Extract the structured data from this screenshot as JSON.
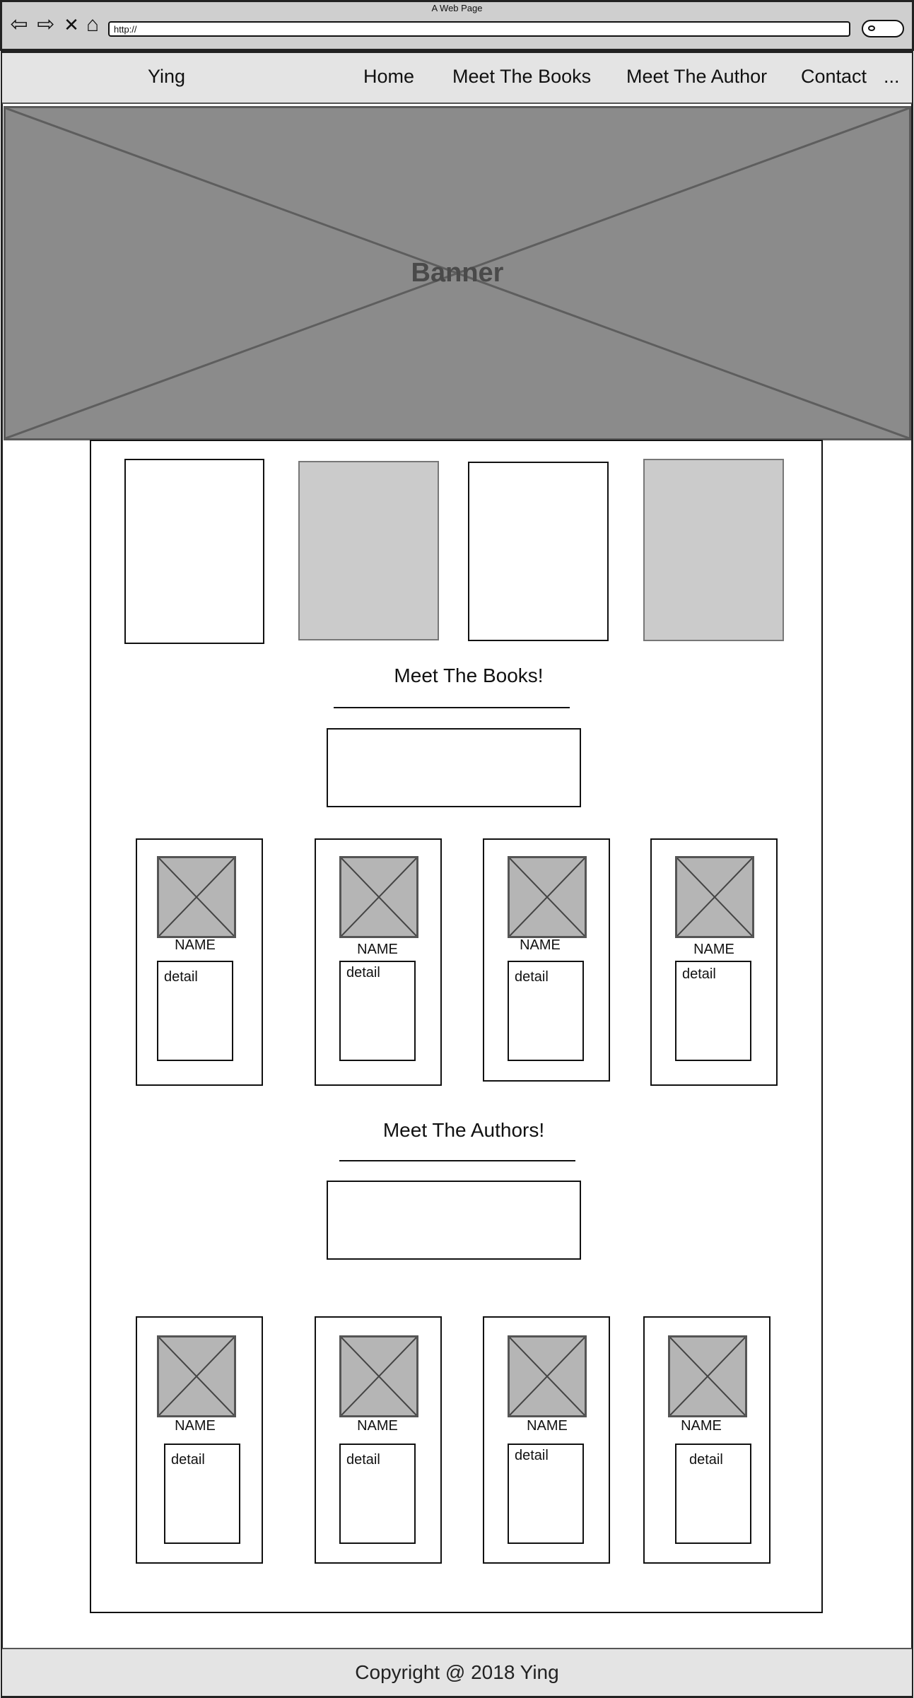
{
  "browser": {
    "window_title": "A Web Page",
    "url": "http://",
    "icons": [
      "back-arrow-icon",
      "forward-arrow-icon",
      "close-x-icon",
      "home-icon",
      "search-icon"
    ]
  },
  "nav": {
    "brand": "Ying",
    "links": [
      "Home",
      "Meet The Books",
      "Meet The Author",
      "Contact"
    ],
    "more": "..."
  },
  "banner": {
    "label": "Banner"
  },
  "books": {
    "heading": "Meet The Books!",
    "cards": [
      {
        "name": "NAME",
        "detail": "detail"
      },
      {
        "name": "NAME",
        "detail": "detail"
      },
      {
        "name": "NAME",
        "detail": "detail"
      },
      {
        "name": "NAME",
        "detail": "detail"
      }
    ]
  },
  "authors": {
    "heading": "Meet The Authors!",
    "cards": [
      {
        "name": "NAME",
        "detail": "detail"
      },
      {
        "name": "NAME",
        "detail": "detail"
      },
      {
        "name": "NAME",
        "detail": "detail"
      },
      {
        "name": "NAME",
        "detail": "detail"
      }
    ]
  },
  "footer": {
    "text": "Copyright @ 2018 Ying"
  },
  "colors": {
    "chrome": "#cfcfcf",
    "navbar": "#e4e4e4",
    "banner": "#8b8b8b",
    "placeholder_fill": "#b5b5b5",
    "feature_gray": "#cbcbcb"
  }
}
